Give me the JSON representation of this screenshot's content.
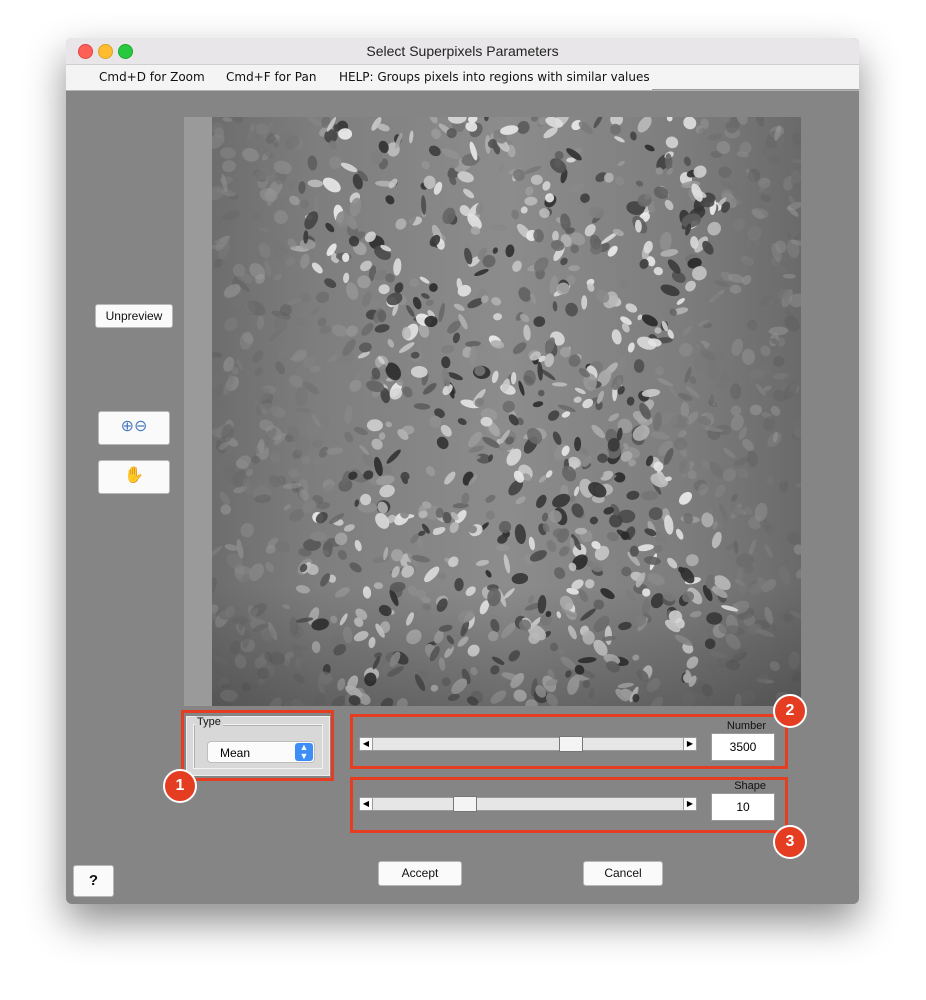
{
  "window": {
    "title": "Select Superpixels Parameters"
  },
  "menu": {
    "zoom_hint": "Cmd+D for Zoom",
    "pan_hint": "Cmd+F for Pan",
    "help_text": "HELP:  Groups pixels into regions with similar values"
  },
  "buttons": {
    "unpreview": "Unpreview",
    "zoom_icons": "⊕⊖",
    "pan_icon": "✋",
    "help": "?",
    "accept": "Accept",
    "cancel": "Cancel"
  },
  "type_panel": {
    "label": "Type",
    "selected": "Mean"
  },
  "number_slider": {
    "label": "Number",
    "value": "3500",
    "level": 0.65
  },
  "shape_slider": {
    "label": "Shape",
    "value": "10",
    "level": 0.28
  },
  "annotations": [
    "1",
    "2",
    "3"
  ],
  "colors": {
    "annotation_red": "#e53d22",
    "window_bg": "#858585",
    "select_blue": "#3c8df5"
  }
}
